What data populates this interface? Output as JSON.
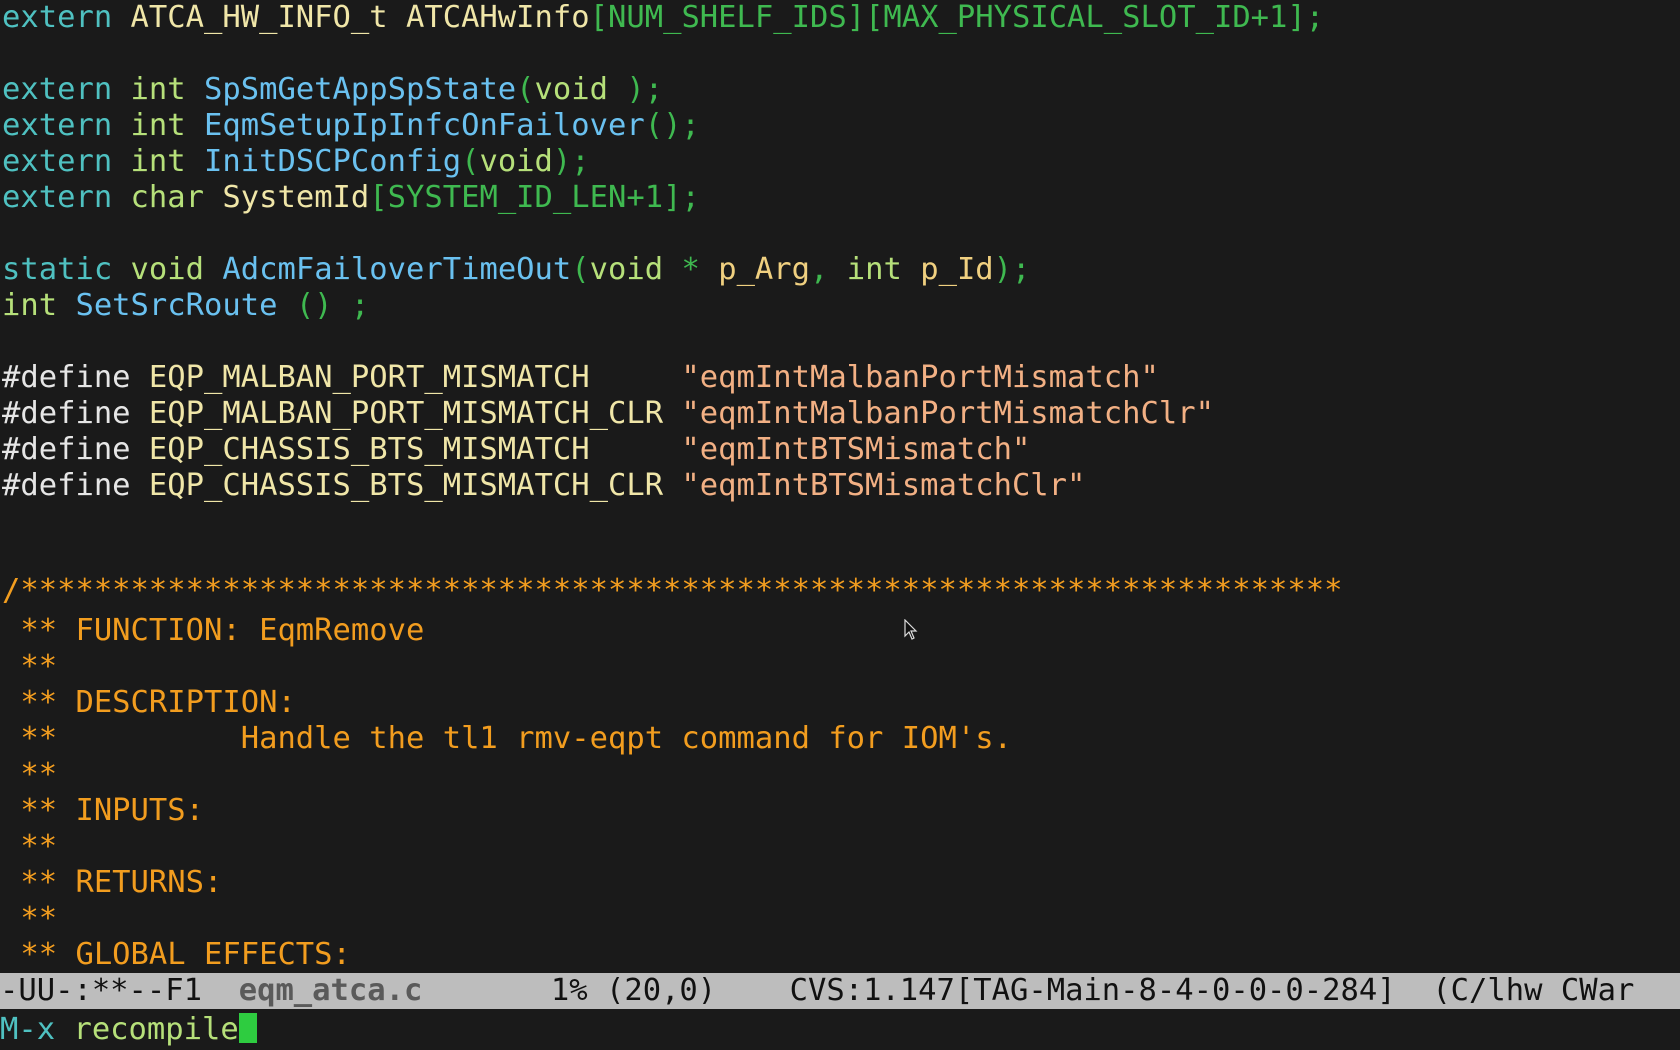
{
  "editor": {
    "lines": [
      {
        "id": "l1",
        "segments": [
          [
            "kw-extern",
            "extern "
          ],
          [
            "ident",
            "ATCA_HW_INFO_t ATCAHwInfo"
          ],
          [
            "bracket",
            "[NUM_SHELF_IDS][MAX_PHYSICAL_SLOT_ID+1];"
          ]
        ]
      },
      {
        "id": "l3",
        "segments": [
          [
            "kw-extern",
            "extern "
          ],
          [
            "type",
            "int "
          ],
          [
            "func",
            "SpSmGetAppSpState"
          ],
          [
            "bracket",
            "("
          ],
          [
            "type",
            "void "
          ],
          [
            "bracket",
            ");"
          ]
        ]
      },
      {
        "id": "l4",
        "segments": [
          [
            "kw-extern",
            "extern "
          ],
          [
            "type",
            "int "
          ],
          [
            "func",
            "EqmSetupIpInfcOnFailover"
          ],
          [
            "bracket",
            "();"
          ]
        ]
      },
      {
        "id": "l5",
        "segments": [
          [
            "kw-extern",
            "extern "
          ],
          [
            "type",
            "int "
          ],
          [
            "func",
            "InitDSCPConfig"
          ],
          [
            "bracket",
            "("
          ],
          [
            "type",
            "void"
          ],
          [
            "bracket",
            ");"
          ]
        ]
      },
      {
        "id": "l6",
        "segments": [
          [
            "kw-extern",
            "extern "
          ],
          [
            "type",
            "char "
          ],
          [
            "ident",
            "SystemId"
          ],
          [
            "bracket",
            "[SYSTEM_ID_LEN+1];"
          ]
        ]
      },
      {
        "id": "l8",
        "segments": [
          [
            "kw-extern",
            "static "
          ],
          [
            "type",
            "void "
          ],
          [
            "func",
            "AdcmFailoverTimeOut"
          ],
          [
            "bracket",
            "("
          ],
          [
            "type",
            "void "
          ],
          [
            "green",
            "* "
          ],
          [
            "param",
            "p_Arg"
          ],
          [
            "green",
            ", "
          ],
          [
            "type",
            "int "
          ],
          [
            "param",
            "p_Id"
          ],
          [
            "bracket",
            ");"
          ]
        ]
      },
      {
        "id": "l9",
        "segments": [
          [
            "type",
            "int "
          ],
          [
            "func",
            "SetSrcRoute "
          ],
          [
            "bracket",
            "() ;"
          ]
        ]
      },
      {
        "id": "l11",
        "segments": [
          [
            "preproc",
            "#define "
          ],
          [
            "macro",
            "EQP_MALBAN_PORT_MISMATCH     "
          ],
          [
            "string",
            "\"eqmIntMalbanPortMismatch\""
          ]
        ]
      },
      {
        "id": "l12",
        "segments": [
          [
            "preproc",
            "#define "
          ],
          [
            "macro",
            "EQP_MALBAN_PORT_MISMATCH_CLR "
          ],
          [
            "string",
            "\"eqmIntMalbanPortMismatchClr\""
          ]
        ]
      },
      {
        "id": "l13",
        "segments": [
          [
            "preproc",
            "#define "
          ],
          [
            "macro",
            "EQP_CHASSIS_BTS_MISMATCH     "
          ],
          [
            "string",
            "\"eqmIntBTSMismatch\""
          ]
        ]
      },
      {
        "id": "l14",
        "segments": [
          [
            "preproc",
            "#define "
          ],
          [
            "macro",
            "EQP_CHASSIS_BTS_MISMATCH_CLR "
          ],
          [
            "string",
            "\"eqmIntBTSMismatchClr\""
          ]
        ]
      },
      {
        "id": "l17",
        "segments": [
          [
            "comment",
            "/************************************************************************"
          ]
        ]
      },
      {
        "id": "l18",
        "segments": [
          [
            "comment",
            " ** FUNCTION: EqmRemove"
          ]
        ]
      },
      {
        "id": "l19",
        "segments": [
          [
            "comment",
            " **"
          ]
        ]
      },
      {
        "id": "l20",
        "segments": [
          [
            "comment",
            " ** DESCRIPTION:"
          ]
        ]
      },
      {
        "id": "l21",
        "segments": [
          [
            "comment",
            " **          Handle the tl1 rmv-eqpt command for IOM's."
          ]
        ]
      },
      {
        "id": "l22",
        "segments": [
          [
            "comment",
            " **"
          ]
        ]
      },
      {
        "id": "l23",
        "segments": [
          [
            "comment",
            " ** INPUTS:"
          ]
        ]
      },
      {
        "id": "l24",
        "segments": [
          [
            "comment",
            " **"
          ]
        ]
      },
      {
        "id": "l25",
        "segments": [
          [
            "comment",
            " ** RETURNS:"
          ]
        ]
      },
      {
        "id": "l26",
        "segments": [
          [
            "comment",
            " **"
          ]
        ]
      },
      {
        "id": "l27",
        "segments": [
          [
            "comment",
            " ** GLOBAL EFFECTS:"
          ]
        ]
      }
    ]
  },
  "modeline": {
    "status": "-UU-:**--F1  ",
    "buffer_name": "eqm_atca.c",
    "position": "       1% (20,0)    ",
    "vc_info": "CVS:1.147[TAG-Main-8-4-0-0-0-284]",
    "modes": "  (C/lhw CWar"
  },
  "minibuffer": {
    "prompt": "M-x ",
    "input": "recompile"
  }
}
